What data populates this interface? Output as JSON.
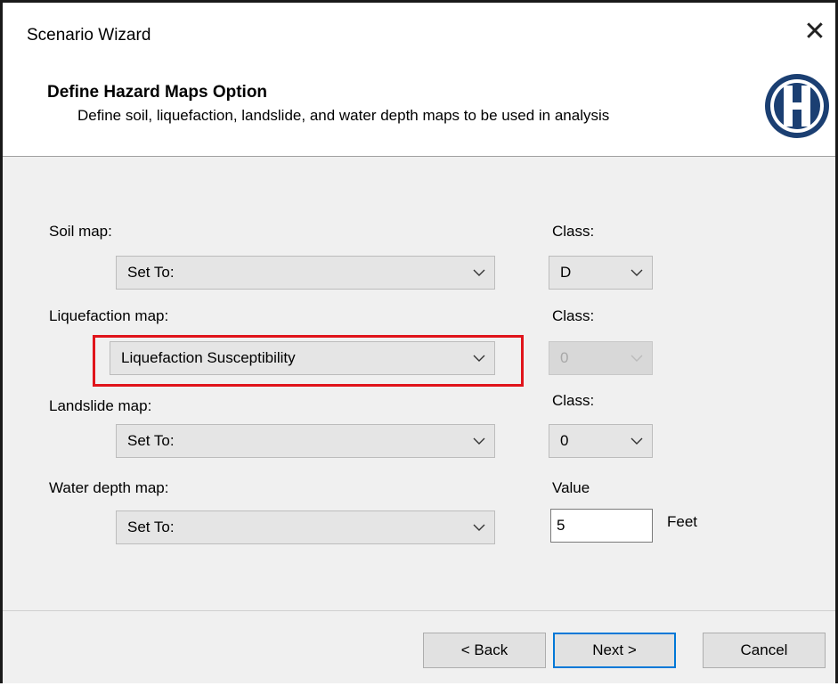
{
  "window": {
    "title": "Scenario Wizard"
  },
  "header": {
    "title": "Define Hazard Maps Option",
    "subtitle": "Define soil, liquefaction, landslide, and water depth maps to be used in analysis"
  },
  "soil": {
    "label": "Soil map:",
    "value": "Set To:",
    "class_label": "Class:",
    "class_value": "D"
  },
  "liquefaction": {
    "label": "Liquefaction map:",
    "value": "Liquefaction Susceptibility",
    "class_label": "Class:",
    "class_value": "0"
  },
  "landslide": {
    "label": "Landslide map:",
    "value": "Set To:",
    "class_label": "Class:",
    "class_value": "0"
  },
  "water": {
    "label": "Water depth map:",
    "value": "Set To:",
    "value_label": "Value",
    "depth": "5",
    "unit": "Feet"
  },
  "buttons": {
    "back": "< Back",
    "next": "Next >",
    "cancel": "Cancel"
  },
  "colors": {
    "highlight": "#e0141b",
    "logo": "#1b3f72",
    "focus": "#0078d7"
  }
}
